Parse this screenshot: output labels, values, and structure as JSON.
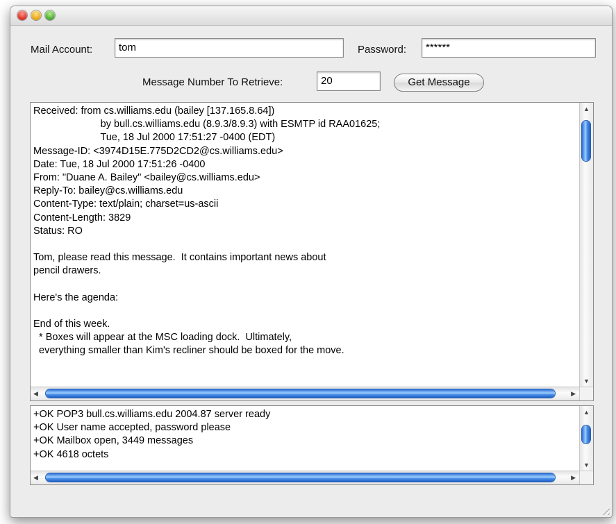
{
  "form": {
    "mail_account_label": "Mail Account:",
    "mail_account_value": "tom",
    "password_label": "Password:",
    "password_value": "******",
    "message_number_label": "Message Number To Retrieve:",
    "message_number_value": "20",
    "get_message_label": "Get Message"
  },
  "message_lines": [
    "Received: from cs.williams.edu (bailey [137.165.8.64])",
    "                        by bull.cs.williams.edu (8.9.3/8.9.3) with ESMTP id RAA01625;",
    "                        Tue, 18 Jul 2000 17:51:27 -0400 (EDT)",
    "Message-ID: <3974D15E.775D2CD2@cs.williams.edu>",
    "Date: Tue, 18 Jul 2000 17:51:26 -0400",
    "From: \"Duane A. Bailey\" <bailey@cs.williams.edu>",
    "Reply-To: bailey@cs.williams.edu",
    "Content-Type: text/plain; charset=us-ascii",
    "Content-Length: 3829",
    "Status: RO",
    "",
    "Tom, please read this message.  It contains important news about",
    "pencil drawers.",
    "",
    "Here's the agenda:",
    "",
    "End of this week.",
    "  * Boxes will appear at the MSC loading dock.  Ultimately,",
    "  everything smaller than Kim's recliner should be boxed for the move."
  ],
  "log_lines": [
    "+OK POP3 bull.cs.williams.edu 2004.87 server ready",
    "+OK User name accepted, password please",
    "+OK Mailbox open, 3449 messages",
    "+OK 4618 octets"
  ],
  "colors": {
    "window_bg": "#ececec",
    "scroll_thumb": "#4f93ea",
    "close_button": "#d8271c",
    "minimize_button": "#e6a10b",
    "zoom_button": "#3fa52a"
  }
}
